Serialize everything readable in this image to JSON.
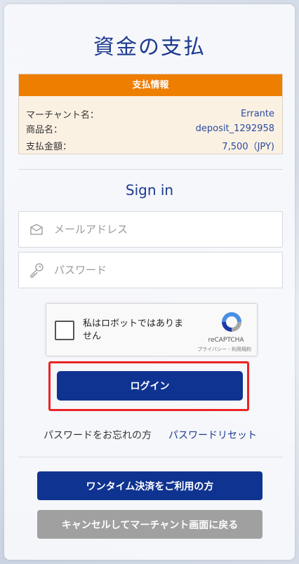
{
  "page": {
    "title": "資金の支払"
  },
  "payment_info": {
    "header": "支払情報",
    "rows": [
      {
        "label": "マーチャント名：",
        "value": "Errante"
      },
      {
        "label": "商品名：",
        "value": "deposit_1292958"
      },
      {
        "label": "支払金額：",
        "value": "7,500（JPY)"
      }
    ]
  },
  "signin": {
    "title": "Sign in",
    "email_placeholder": "メールアドレス",
    "password_placeholder": "パスワード"
  },
  "captcha": {
    "label": "私はロボットではありません",
    "brand": "reCAPTCHA",
    "terms": "プライバシー - 利用規約"
  },
  "login_button": "ログイン",
  "forgot": {
    "text": "パスワードをお忘れの方",
    "link": "パスワードリセット"
  },
  "actions": {
    "onetime": "ワンタイム決済をご利用の方",
    "cancel": "キャンセルしてマーチャント画面に戻る"
  },
  "colors": {
    "brand_blue": "#0f3391",
    "accent_orange": "#ee7e00",
    "highlight_red": "#ec2323",
    "cancel_gray": "#a0a0a0"
  }
}
